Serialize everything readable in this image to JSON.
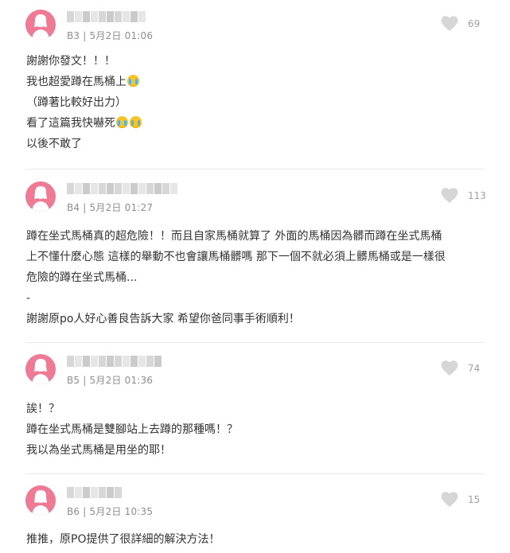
{
  "colors": {
    "avatar": "#f07995",
    "heart": "#d6d6d6",
    "meta_text": "#8e8e8e",
    "body_text": "#333333"
  },
  "comments": [
    {
      "meta": "B3 | 5月2日 01:06",
      "likes": "69",
      "lines": [
        "謝謝你發文！！！",
        "我也超愛蹲在馬桶上",
        "（蹲著比較好出力）",
        "看了這篇我快嚇死",
        "以後不敢了"
      ],
      "emojis": {
        "1": 1,
        "3": 2
      }
    },
    {
      "meta": "B4 | 5月2日 01:27",
      "likes": "113",
      "lines": [
        "蹲在坐式馬桶真的超危險！！而且自家馬桶就算了 外面的馬桶因為髒而蹲在坐式馬桶",
        "上不懂什麼心態 這樣的舉動不也會讓馬桶髒嗎 那下一個不就必須上髒馬桶或是一樣很",
        "危險的蹲在坐式馬桶...",
        "-",
        "謝謝原po人好心善良告訴大家 希望你爸同事手術順利！"
      ]
    },
    {
      "meta": "B5 | 5月2日 01:36",
      "likes": "74",
      "lines": [
        "誒！？",
        "蹲在坐式馬桶是雙腳站上去蹲的那種嗎！？",
        "我以為坐式馬桶是用坐的耶！"
      ]
    },
    {
      "meta": "B6 | 5月2日 10:35",
      "likes": "15",
      "lines": [
        "推推，原PO提供了很詳細的解決方法！"
      ]
    }
  ]
}
